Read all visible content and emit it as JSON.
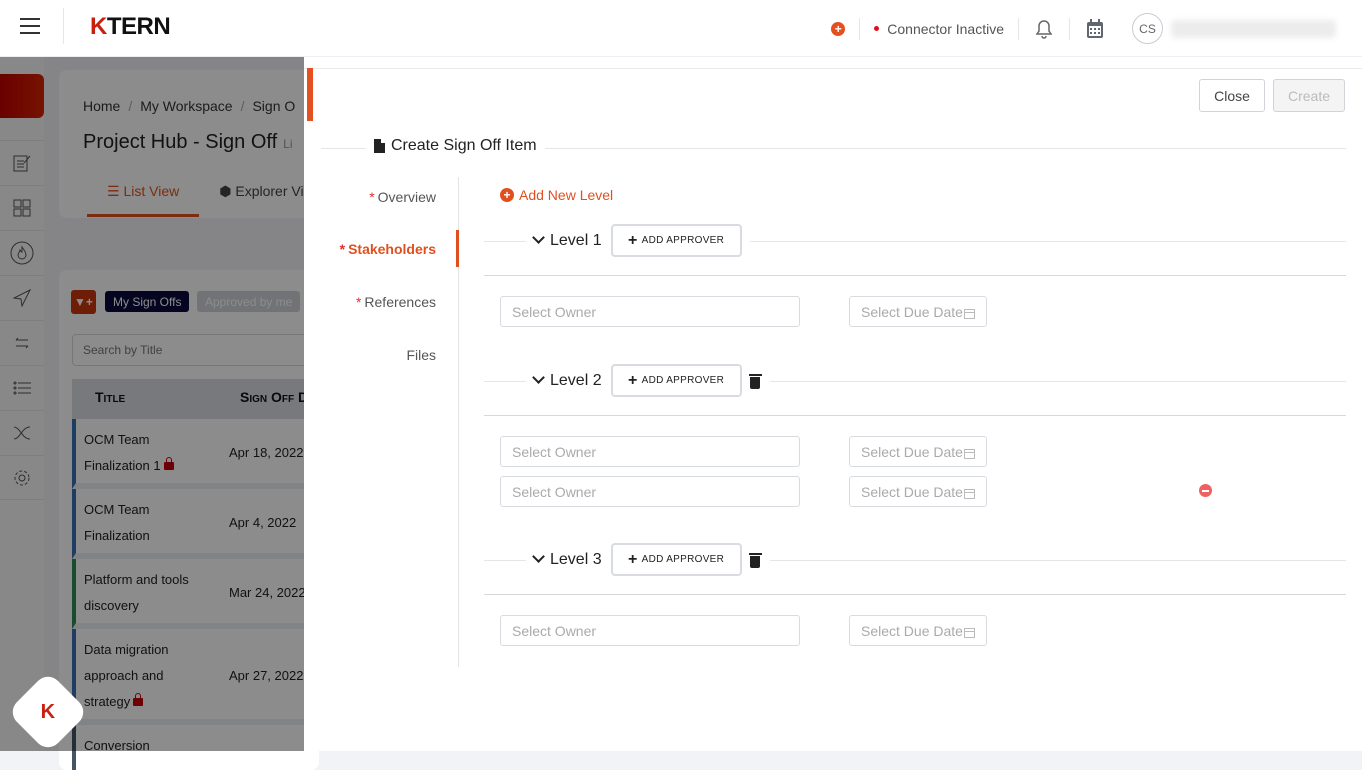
{
  "topbar": {
    "brand": {
      "k": "K",
      "rest": "TERN"
    },
    "connector_status": "Connector Inactive",
    "avatar_initials": "CS",
    "accent": "#e4501f"
  },
  "background": {
    "breadcrumb": [
      "Home",
      "My Workspace",
      "Sign O"
    ],
    "page_title": "Project Hub - Sign Off",
    "page_title_suffix": "Li",
    "tabs": [
      {
        "label": "List View",
        "active": true
      },
      {
        "label": "Explorer Vi",
        "active": false
      }
    ],
    "filters": {
      "my_sign_offs": "My Sign Offs",
      "approved_by_me": "Approved by me"
    },
    "search_placeholder": "Search by Title",
    "table": {
      "columns": [
        "Title",
        "Sign Off D"
      ],
      "rows": [
        {
          "title": "OCM Team Finalization 1",
          "date": "Apr 18, 2022",
          "locked": true
        },
        {
          "title": "OCM Team Finalization",
          "date": "Apr 4, 2022",
          "locked": false
        },
        {
          "title": "Platform and tools discovery",
          "date": "Mar 24, 2022",
          "locked": false
        },
        {
          "title": "Data migration approach and strategy",
          "date": "Apr 27, 2022",
          "locked": true
        },
        {
          "title": "Conversion",
          "date": "",
          "locked": false
        }
      ]
    },
    "fab_label": "K"
  },
  "drawer": {
    "close_label": "Close",
    "create_label": "Create",
    "section_title": "Create Sign Off Item",
    "steps": [
      {
        "label": "Overview",
        "required": true,
        "active": false
      },
      {
        "label": "Stakeholders",
        "required": true,
        "active": true
      },
      {
        "label": "References",
        "required": true,
        "active": false
      },
      {
        "label": "Files",
        "required": false,
        "active": false
      }
    ],
    "add_level_label": "Add New Level",
    "add_approver_label": "ADD APPROVER",
    "owner_placeholder": "Select Owner",
    "due_placeholder": "Select Due Date",
    "levels": [
      {
        "name": "Level 1",
        "deletable": false,
        "approvers": 1
      },
      {
        "name": "Level 2",
        "deletable": true,
        "approvers": 2
      },
      {
        "name": "Level 3",
        "deletable": true,
        "approvers": 1
      }
    ]
  }
}
